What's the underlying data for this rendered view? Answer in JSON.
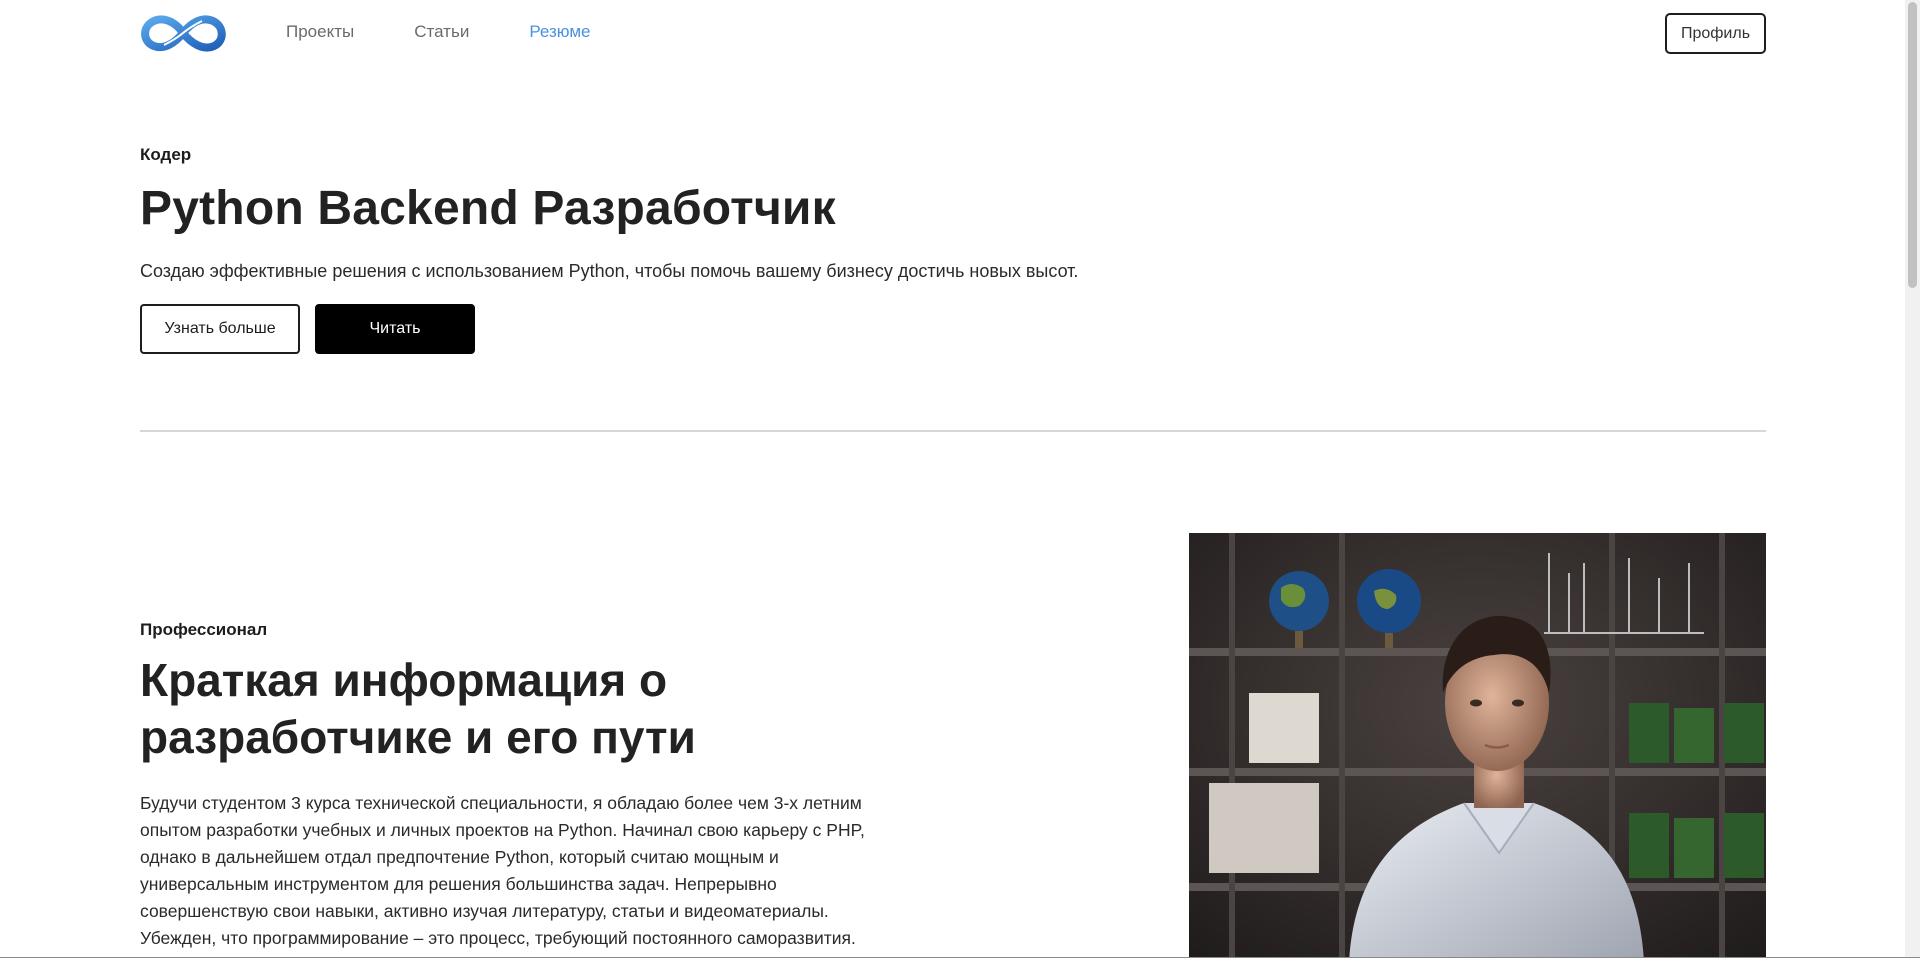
{
  "nav": {
    "logo_icon": "infinity-logo-icon",
    "items": [
      {
        "label": "Проекты"
      },
      {
        "label": "Статьи"
      },
      {
        "label": "Резюме"
      }
    ],
    "profile_label": "Профиль"
  },
  "hero": {
    "eyebrow": "Кодер",
    "title": "Python Backend Разработчик",
    "subtitle": "Создаю эффективные решения с использованием Python, чтобы помочь вашему бизнесу достичь новых высот.",
    "learn_more_label": "Узнать больше",
    "read_label": "Читать"
  },
  "about": {
    "eyebrow": "Профессионал",
    "title": "Краткая информация о разработчике и его пути",
    "text": "Будучи студентом 3 курса технической специальности, я обладаю более чем 3-х летним опытом разработки учебных и личных проектов на Python. Начинал свою карьеру с PHP, однако в дальнейшем отдал предпочтение Python, который считаю мощным и универсальным инструментом для решения большинства задач. Непрерывно совершенствую свои навыки, активно изучая литературу, статьи и видеоматериалы. Убежден, что программирование – это процесс, требующий постоянного саморазвития."
  },
  "colors": {
    "accent": "#4a90e2",
    "text": "#1d1d1d",
    "button_dark": "#000000"
  }
}
